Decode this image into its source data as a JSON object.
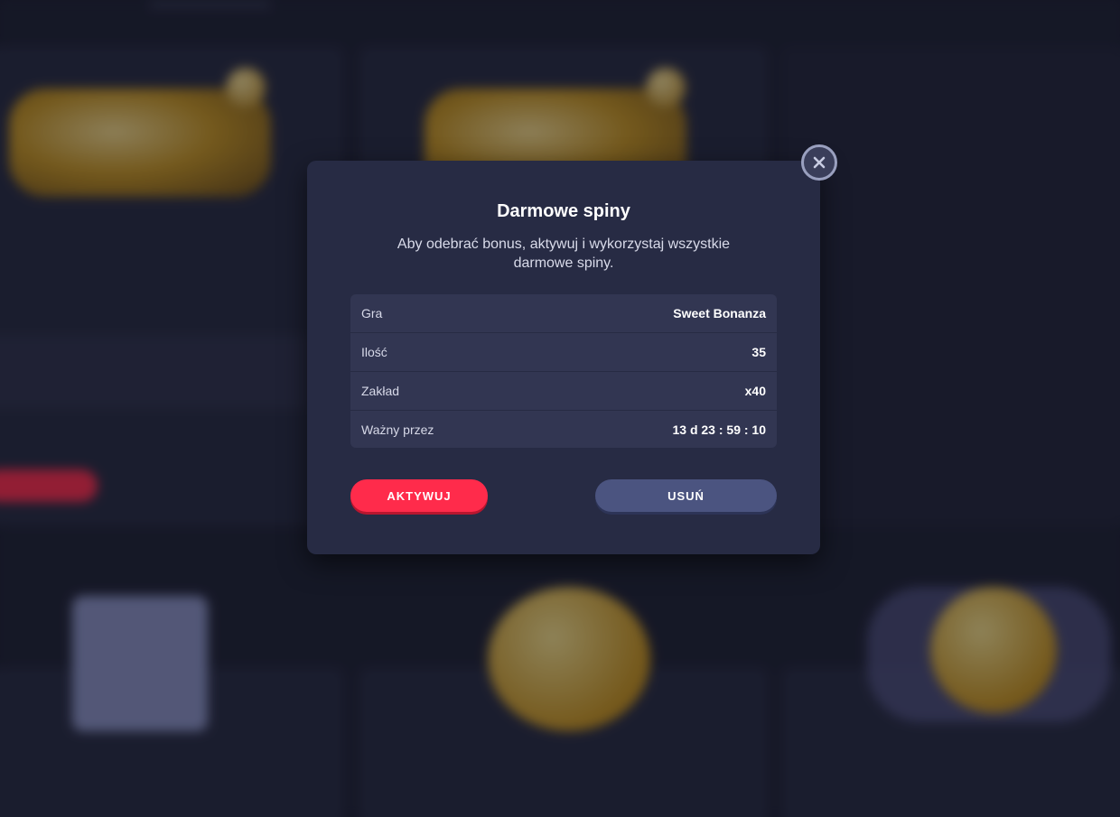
{
  "modal": {
    "title": "Darmowe spiny",
    "description": "Aby odebrać bonus, aktywuj i wykorzystaj wszystkie darmowe spiny.",
    "rows": [
      {
        "label": "Gra",
        "value": "Sweet Bonanza"
      },
      {
        "label": "Ilość",
        "value": "35"
      },
      {
        "label": "Zakład",
        "value": "x40"
      },
      {
        "label": "Ważny przez",
        "value": "13 d 23 : 59 : 10"
      }
    ],
    "activate_label": "AKTYWUJ",
    "remove_label": "USUŃ",
    "close_icon": "close-icon"
  },
  "colors": {
    "modal_bg": "#272b44",
    "activate_button": "#ff2b4b",
    "remove_button": "#4b5480"
  }
}
